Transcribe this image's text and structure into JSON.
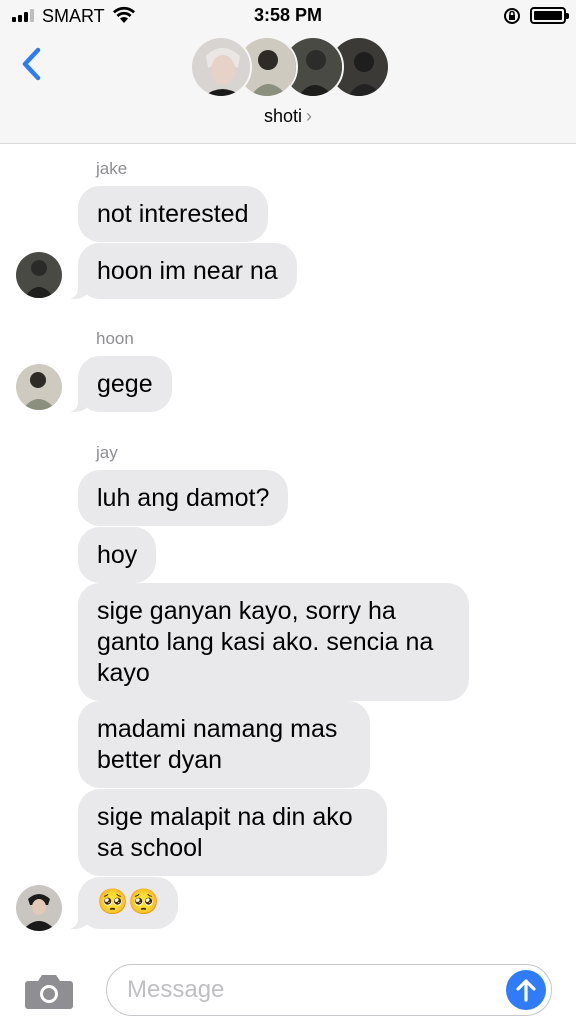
{
  "status_bar": {
    "carrier": "SMART",
    "time": "3:58 PM"
  },
  "header": {
    "group_name": "shoti",
    "chevron": "›"
  },
  "messages": [
    {
      "sender": "jake",
      "bubbles": [
        "not interested",
        "hoon im near na"
      ]
    },
    {
      "sender": "hoon",
      "bubbles": [
        "gege"
      ]
    },
    {
      "sender": "jay",
      "bubbles": [
        "luh ang damot?",
        "hoy",
        "sige ganyan kayo, sorry ha ganto lang kasi ako. sencia na kayo",
        "madami namang mas better dyan",
        "sige malapit na din ako sa school",
        "🥺🥺"
      ]
    }
  ],
  "composer": {
    "placeholder": "Message"
  },
  "icons": {
    "back": "chevron-left-icon",
    "camera": "camera-icon",
    "send": "arrow-up-icon",
    "wifi": "wifi-icon",
    "battery": "battery-icon",
    "rotation_lock": "rotation-lock-icon"
  },
  "colors": {
    "accent": "#2f7cf6",
    "bubble_gray": "#e9e9eb",
    "header_bg": "#f6f6f6",
    "sender_gray": "#8e8e93"
  }
}
